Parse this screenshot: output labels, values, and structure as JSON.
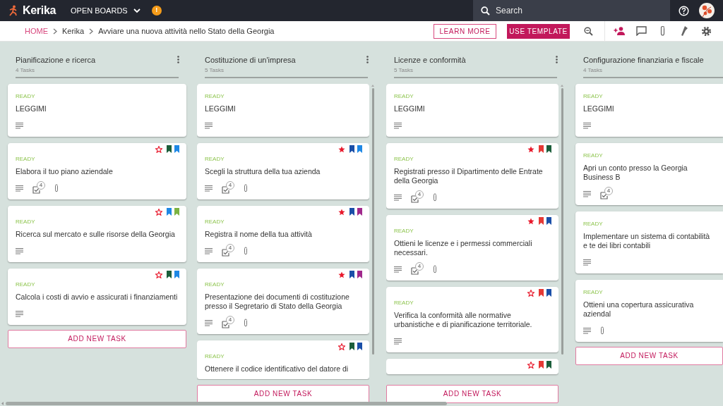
{
  "app": {
    "logo": "Kerika",
    "menu": "OPEN BOARDS",
    "alert_badge": "!"
  },
  "search": {
    "placeholder": "Search"
  },
  "breadcrumb": [
    "HOME",
    "Kerika",
    "Avviare una nuova attività nello Stato della Georgia"
  ],
  "buttons": [
    {
      "label": "LEARN MORE",
      "kind": "outline"
    },
    {
      "label": "USE TEMPLATE",
      "kind": "filled"
    }
  ],
  "columns": [
    {
      "title": "Pianificazione e ricerca",
      "count": "4 Tasks",
      "has_menu": true,
      "scrollable": false,
      "add_button": "ADD NEW TASK",
      "cards": [
        {
          "status": "READY",
          "title": "LEGGIMI",
          "description": true
        },
        {
          "status": "READY",
          "title": "Elabora il tuo piano aziendale",
          "starred": false,
          "tags": [
            {
              "color": "#1b5e3a"
            },
            {
              "color": "#1e88e5"
            }
          ],
          "description": true,
          "checklist": "4",
          "attachment": true
        },
        {
          "status": "READY",
          "title": "Ricerca sul mercato e sulle risorse della Georgia",
          "starred": false,
          "tags": [
            {
              "color": "#1e88e5"
            },
            {
              "color": "#7cb342"
            }
          ],
          "description": true
        },
        {
          "status": "READY",
          "title": "Calcola i costi di avvio e assicurati i finanziamenti",
          "starred": false,
          "tags": [
            {
              "color": "#1b5e3a"
            },
            {
              "color": "#1e88e5"
            }
          ],
          "description": true
        }
      ]
    },
    {
      "title": "Costituzione di un'impresa",
      "count": "5 Tasks",
      "has_menu": true,
      "scrollable": true,
      "add_button": "ADD NEW TASK",
      "cards": [
        {
          "status": "READY",
          "title": "LEGGIMI",
          "description": true
        },
        {
          "status": "READY",
          "title": "Scegli la struttura della tua azienda",
          "starred": true,
          "tags": [
            {
              "color": "#1a4fa8"
            },
            {
              "color": "#1e88e5"
            }
          ],
          "description": true,
          "checklist": "4",
          "attachment": true
        },
        {
          "status": "READY",
          "title": "Registra il nome della tua attività",
          "starred": true,
          "tags": [
            {
              "color": "#1a4fa8"
            },
            {
              "color": "#a0288c"
            }
          ],
          "description": true,
          "checklist": "4",
          "attachment": true
        },
        {
          "status": "READY",
          "title": "Presentazione dei documenti di costituzione presso il Segretario di Stato della Georgia",
          "starred": true,
          "tags": [
            {
              "color": "#1a4fa8"
            },
            {
              "color": "#a0288c"
            }
          ],
          "description": true,
          "checklist": "4",
          "attachment": true
        },
        {
          "status": "READY",
          "title": "Ottenere il codice identificativo del datore di",
          "starred": false,
          "tags": [
            {
              "color": "#1b5e3a"
            },
            {
              "color": "#1a4fa8"
            }
          ]
        }
      ]
    },
    {
      "title": "Licenze e conformità",
      "count": "5 Tasks",
      "has_menu": true,
      "scrollable": true,
      "add_button": "ADD NEW TASK",
      "cards": [
        {
          "status": "READY",
          "title": "LEGGIMI",
          "description": true
        },
        {
          "status": "READY",
          "title": "Registrati presso il Dipartimento delle Entrate della Georgia",
          "starred": true,
          "tags": [
            {
              "color": "#e53935"
            },
            {
              "color": "#1b5e3a"
            }
          ],
          "description": true,
          "checklist": "4",
          "attachment": true
        },
        {
          "status": "READY",
          "title": "Ottieni le licenze e i permessi commerciali necessari.",
          "starred": true,
          "tags": [
            {
              "color": "#e53935"
            },
            {
              "color": "#1a4fa8"
            }
          ],
          "description": true,
          "checklist": "4",
          "attachment": true
        },
        {
          "status": "READY",
          "title": "Verifica la conformità alle normative urbanistiche e di pianificazione territoriale.",
          "starred": false,
          "tags": [
            {
              "color": "#e53935"
            },
            {
              "color": "#1a4fa8"
            }
          ],
          "description": true
        },
        {
          "starred": false,
          "tags": [
            {
              "color": "#e53935"
            },
            {
              "color": "#1b5e3a"
            }
          ]
        }
      ]
    },
    {
      "title": "Configurazione finanziaria e fiscale",
      "count": "4 Tasks",
      "has_menu": false,
      "scrollable": false,
      "add_button": "ADD NEW TASK",
      "cards": [
        {
          "status": "READY",
          "title": "LEGGIMI",
          "description": true
        },
        {
          "status": "READY",
          "title": "Apri un conto presso la Georgia Business B",
          "description": true,
          "checklist": "4"
        },
        {
          "status": "READY",
          "title": "Implementare un sistema di contabilità e te dei libri contabili",
          "description": true
        },
        {
          "status": "READY",
          "title": "Ottieni una copertura assicurativa aziendal",
          "description": true,
          "attachment": true
        }
      ]
    }
  ]
}
